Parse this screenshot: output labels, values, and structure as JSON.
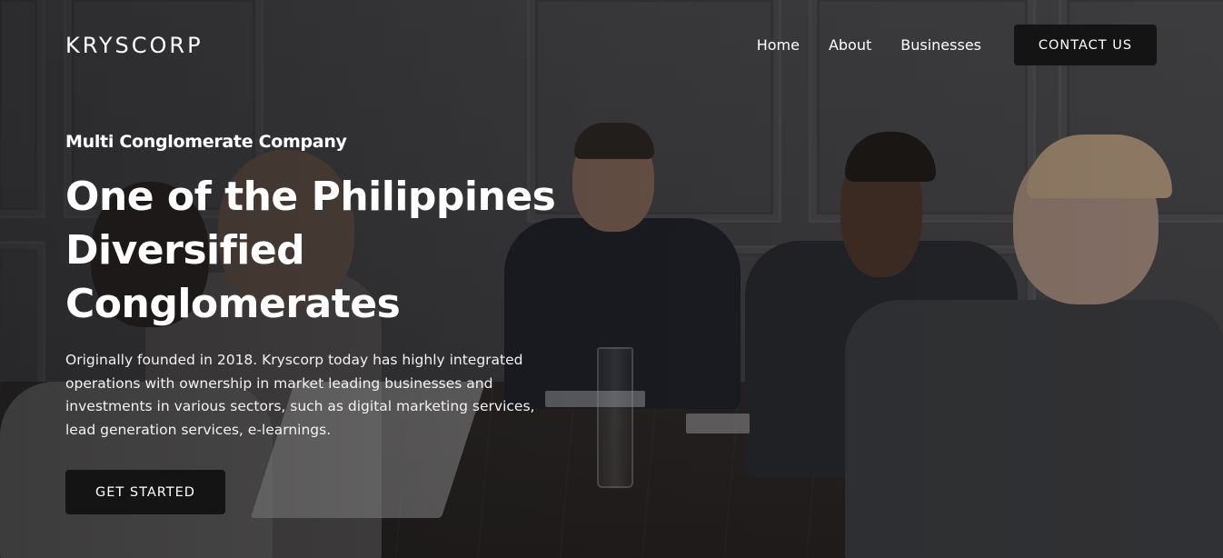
{
  "header": {
    "logo": "KRYSCORP",
    "nav": [
      "Home",
      "About",
      "Businesses"
    ],
    "contact_label": "CONTACT US"
  },
  "hero": {
    "eyebrow": "Multi Conglomerate Company",
    "headline_lines": [
      "One of the Philippines",
      "Diversified",
      "Conglomerates"
    ],
    "description": "Originally founded in 2018. Kryscorp today has highly integrated operations with ownership in market leading businesses and investments in various sectors, such as digital marketing services, lead generation services, e-learnings.",
    "cta_label": "GET STARTED"
  },
  "colors": {
    "button_bg": "#141414",
    "text": "#ffffff"
  }
}
